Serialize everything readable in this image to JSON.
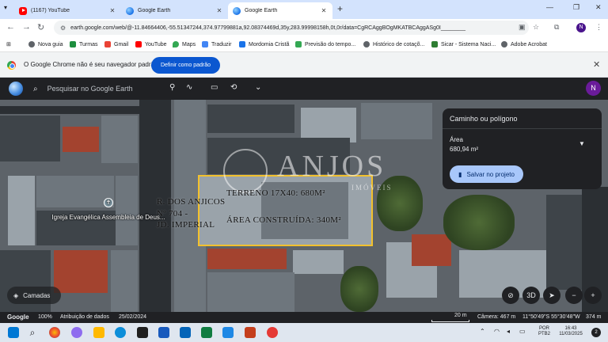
{
  "browser": {
    "tabs": [
      {
        "label": "(1167) YouTube",
        "icon": "youtube-icon"
      },
      {
        "label": "Google Earth",
        "icon": "google-earth-icon"
      },
      {
        "label": "Google Earth",
        "icon": "google-earth-icon"
      }
    ],
    "url": "earth.google.com/web/@-11.84664406,-55.51347244,374.97799881a,92.08374469d,35y,283.99998158h,0t,0r/data=CgRCAggBOgMKATBCAggASg0I________",
    "profile_initial": "N",
    "bookmarks": [
      "Nova guia",
      "Turmas",
      "Gmail",
      "YouTube",
      "Maps",
      "Traduzir",
      "Mordomia Cristã",
      "Previsão do tempo...",
      "Histórico de cotaçõ...",
      "Sicar - Sistema Naci...",
      "Adobe Acrobat"
    ],
    "infobar": {
      "message": "O Google Chrome não é seu navegador padrão",
      "button": "Definir como padrão"
    }
  },
  "earth": {
    "search_placeholder": "Pesquisar no Google Earth",
    "user_initial": "N",
    "panel": {
      "title": "Caminho ou polígono",
      "metric_label": "Área",
      "metric_value": "680,94 m²",
      "save_button": "Salvar no projeto"
    },
    "map_labels": {
      "street": "R. DOS ANJICOS",
      "number": "Nº 704 -",
      "neighborhood": "JD. IMPERIAL",
      "lot": "TERRENO 17X40: 680M²",
      "built": "ÁREA CONSTRUÍDA: 340M²"
    },
    "watermark": {
      "name": "ANJOS",
      "sub": "IMÓVEIS"
    },
    "poi": "Igreja Evangélica Assembleia de Deus...",
    "layers_button": "Camadas",
    "compass_label": "3D",
    "status": {
      "logo": "Google",
      "zoom": "100%",
      "attribution": "Atribuição de dados",
      "date": "25/02/2024",
      "scale": "20 m",
      "camera": "Câmera: 467 m",
      "coords": "11°50'49\"S 55°30'48\"W",
      "altitude": "374 m"
    }
  },
  "taskbar": {
    "lang_line1": "POR",
    "lang_line2": "PTB2",
    "time": "16:43",
    "date": "11/03/2025",
    "notif_count": "2"
  }
}
